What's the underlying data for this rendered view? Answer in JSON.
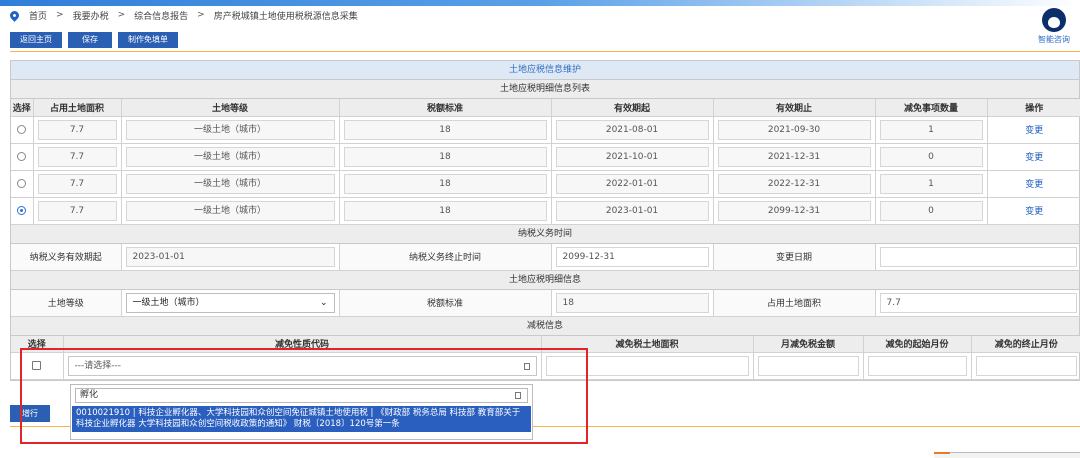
{
  "breadcrumb": [
    "首页",
    "我要办税",
    "综合信息报告",
    "房产税城镇土地使用税税源信息采集"
  ],
  "buttons": {
    "home": "返回主页",
    "save": "保存",
    "exempt": "制作免填单",
    "add_row": "增行"
  },
  "helper": {
    "label": "智能咨询"
  },
  "sections": {
    "main_title": "土地应税信息维护",
    "detail_list": "土地应税明细信息列表",
    "obligation": "纳税义务时间",
    "detail_info": "土地应税明细信息",
    "reduction": "减税信息"
  },
  "detail_table": {
    "headers": [
      "选择",
      "占用土地面积",
      "土地等级",
      "税额标准",
      "有效期起",
      "有效期止",
      "减免事项数量",
      "操作"
    ],
    "rows": [
      {
        "area": "7.7",
        "grade": "一级土地（城市）",
        "standard": "18",
        "start": "2021-08-01",
        "end": "2021-09-30",
        "count": "1",
        "action": "变更",
        "selected": false
      },
      {
        "area": "7.7",
        "grade": "一级土地（城市）",
        "standard": "18",
        "start": "2021-10-01",
        "end": "2021-12-31",
        "count": "0",
        "action": "变更",
        "selected": false
      },
      {
        "area": "7.7",
        "grade": "一级土地（城市）",
        "standard": "18",
        "start": "2022-01-01",
        "end": "2022-12-31",
        "count": "1",
        "action": "变更",
        "selected": false
      },
      {
        "area": "7.7",
        "grade": "一级土地（城市）",
        "standard": "18",
        "start": "2023-01-01",
        "end": "2099-12-31",
        "count": "0",
        "action": "变更",
        "selected": true
      }
    ]
  },
  "obligation": {
    "start_label": "纳税义务有效期起",
    "start_value": "2023-01-01",
    "end_label": "纳税义务终止时间",
    "end_value": "2099-12-31",
    "change_label": "变更日期",
    "change_value": ""
  },
  "detail_info": {
    "grade_label": "土地等级",
    "grade_value": "一级土地（城市）",
    "standard_label": "税额标准",
    "standard_value": "18",
    "area_label": "占用土地面积",
    "area_value": "7.7"
  },
  "reduction_table": {
    "headers": [
      "选择",
      "减免性质代码",
      "减免税土地面积",
      "月减免税金额",
      "减免的起始月份",
      "减免的终止月份"
    ],
    "select_placeholder": "---请选择---"
  },
  "dropdown": {
    "search_value": "孵化",
    "option": "0010021910 | 科技企业孵化器、大学科技园和众创空间免征城镇土地使用税 | 《财政部 税务总局 科技部 教育部关于科技企业孵化器 大学科技园和众创空间税收政策的通知》 财税〔2018〕120号第一条"
  },
  "colors": {
    "primary_button": "#2b5fb4",
    "accent_line": "#f5b54c",
    "highlight_box": "#e0252a"
  }
}
